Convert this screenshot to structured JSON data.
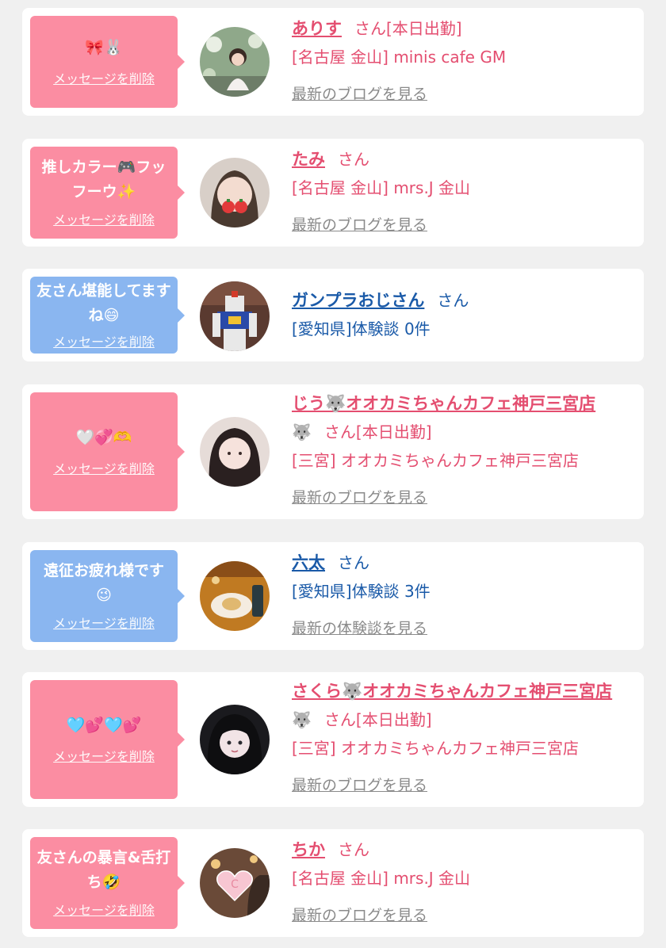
{
  "delete_label": "メッセージを削除",
  "colors": {
    "bubble_pink": "#fb8da2",
    "bubble_blue": "#8ab6f0",
    "text_pink": "#e44e70",
    "text_blue": "#1a5aa8",
    "link_gray": "#8a8a8a"
  },
  "entries": [
    {
      "bubble_color": "pink",
      "message": "🎀🐰",
      "name": "ありす",
      "honorific": "さん[本日出勤]",
      "location": "[名古屋 金山] minis cafe GM",
      "link": "最新のブログを見る",
      "avatar_icon": "avatar-photo-garden-icon"
    },
    {
      "bubble_color": "pink",
      "message": "推しカラー🎮フッフーウ✨",
      "name": "たみ",
      "honorific": "さん",
      "location": "[名古屋 金山] mrs.J 金山",
      "link": "最新のブログを見る",
      "avatar_icon": "avatar-photo-strawberry-icon"
    },
    {
      "bubble_color": "blue",
      "message": "友さん堪能してますね😄",
      "name": "ガンプラおじさん",
      "honorific": "さん",
      "location": "[愛知県]体験談 0件",
      "link": "",
      "avatar_icon": "avatar-photo-gundam-icon"
    },
    {
      "bubble_color": "pink",
      "message": "🤍💞🫶",
      "name": "じう🐺オオカミちゃんカフェ神戸三宮店",
      "name_extra": "🐺",
      "honorific": "さん[本日出勤]",
      "location": "[三宮] オオカミちゃんカフェ神戸三宮店",
      "link": "最新のブログを見る",
      "avatar_icon": "avatar-photo-girl-icon"
    },
    {
      "bubble_color": "blue",
      "message": "遠征お疲れ様です😉",
      "name": "六太",
      "honorific": "さん",
      "location": "[愛知県]体験談 3件",
      "link": "最新の体験談を見る",
      "avatar_icon": "avatar-photo-cafe-dessert-icon"
    },
    {
      "bubble_color": "pink",
      "message": "🩵💕🩵💕",
      "name": "さくら🐺オオカミちゃんカフェ神戸三宮店",
      "name_extra": "🐺",
      "honorific": "さん[本日出勤]",
      "location": "[三宮] オオカミちゃんカフェ神戸三宮店",
      "link": "最新のブログを見る",
      "avatar_icon": "avatar-photo-girl-dark-icon"
    },
    {
      "bubble_color": "pink",
      "message": "友さんの暴言&舌打ち🤣",
      "name": "ちか",
      "honorific": "さん",
      "location": "[名古屋 金山] mrs.J 金山",
      "link": "最新のブログを見る",
      "avatar_icon": "avatar-photo-heart-c-icon"
    }
  ]
}
